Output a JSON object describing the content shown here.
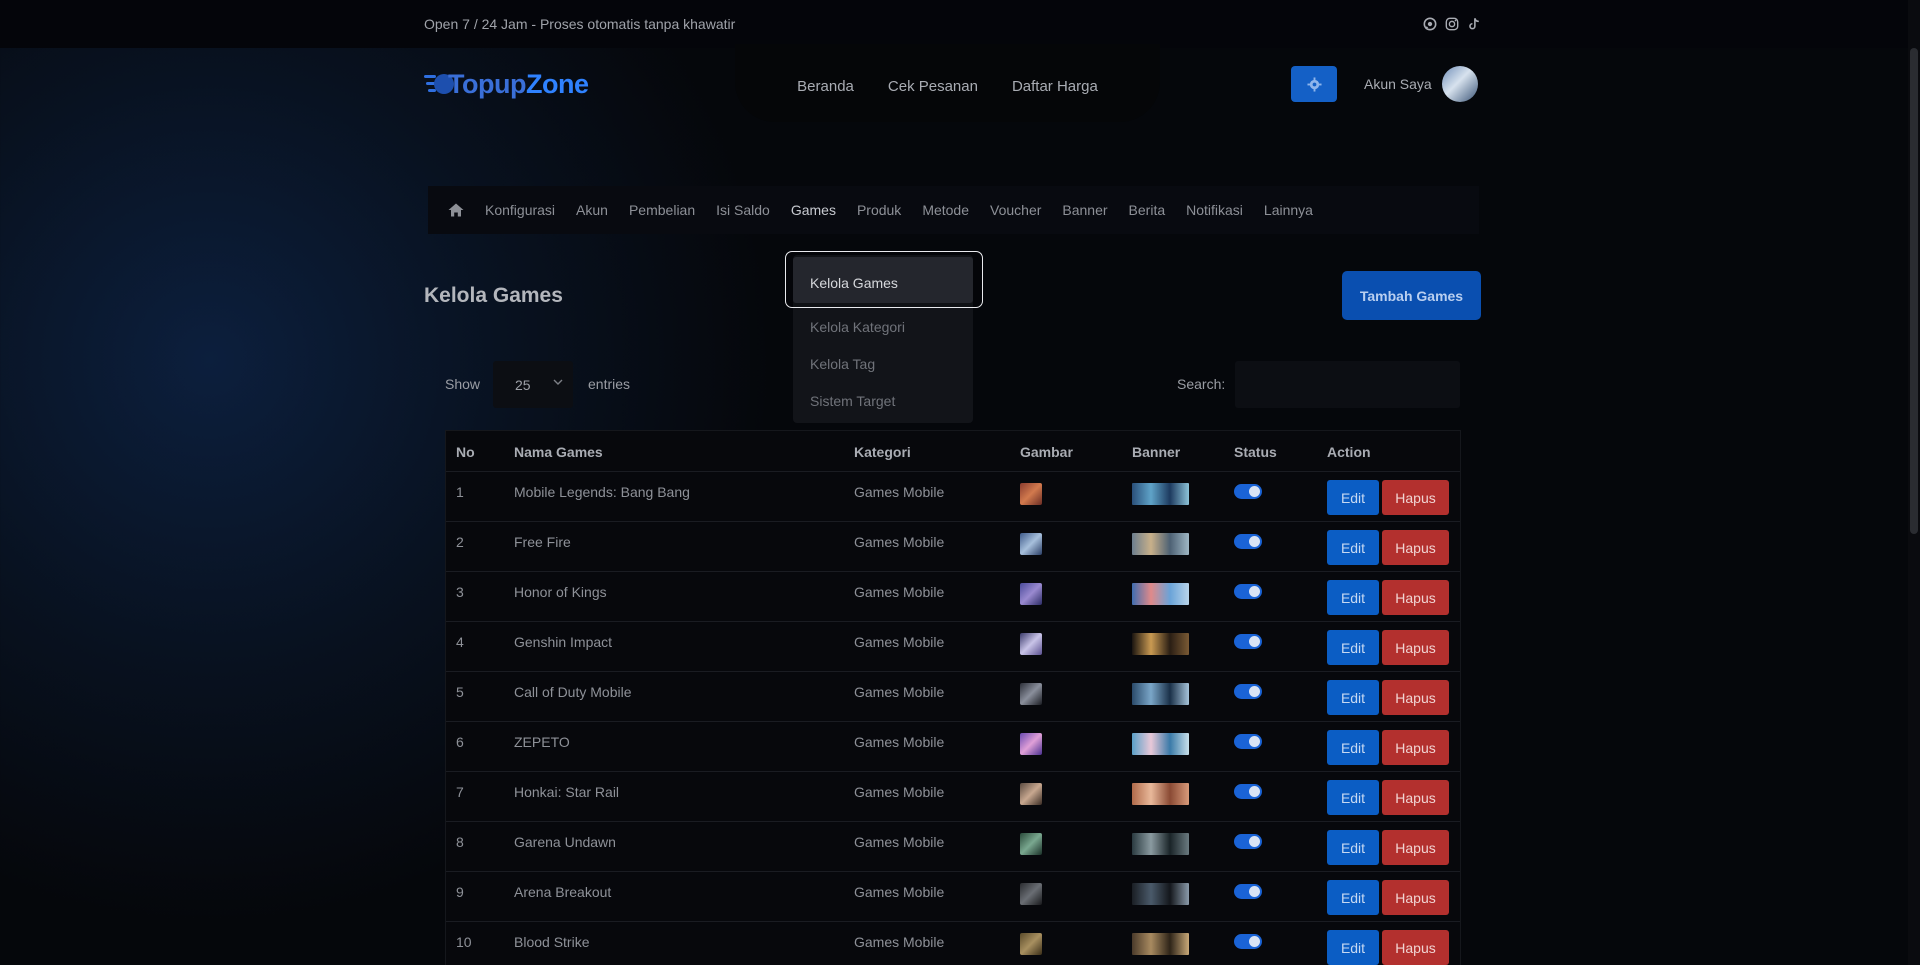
{
  "topbar": {
    "promo": "Open 7 / 24 Jam - Proses otomatis tanpa khawatir",
    "social_icons": [
      "whatsapp-icon",
      "instagram-icon",
      "tiktok-icon"
    ]
  },
  "header": {
    "logo_part1": "Topup",
    "logo_part2": "Zone",
    "nav": [
      "Beranda",
      "Cek Pesanan",
      "Daftar Harga"
    ],
    "account_label": "Akun Saya"
  },
  "menubar": {
    "items": [
      "Konfigurasi",
      "Akun",
      "Pembelian",
      "Isi Saldo",
      "Games",
      "Produk",
      "Metode",
      "Voucher",
      "Banner",
      "Berita",
      "Notifikasi",
      "Lainnya"
    ],
    "active": "Games"
  },
  "dropdown": {
    "items": [
      "Kelola Games",
      "Kelola Kategori",
      "Kelola Tag",
      "Sistem Target"
    ]
  },
  "page": {
    "title": "Kelola Games",
    "add_button": "Tambah Games"
  },
  "table_controls": {
    "show_label": "Show",
    "show_value": "25",
    "entries_label": "entries",
    "search_label": "Search:"
  },
  "table": {
    "headers": [
      "No",
      "Nama Games",
      "Kategori",
      "Gambar",
      "Banner",
      "Status",
      "Action"
    ],
    "edit_label": "Edit",
    "delete_label": "Hapus",
    "rows": [
      {
        "no": "1",
        "name": "Mobile Legends: Bang Bang",
        "kategori": "Games Mobile"
      },
      {
        "no": "2",
        "name": "Free Fire",
        "kategori": "Games Mobile"
      },
      {
        "no": "3",
        "name": "Honor of Kings",
        "kategori": "Games Mobile"
      },
      {
        "no": "4",
        "name": "Genshin Impact",
        "kategori": "Games Mobile"
      },
      {
        "no": "5",
        "name": "Call of Duty Mobile",
        "kategori": "Games Mobile"
      },
      {
        "no": "6",
        "name": "ZEPETO",
        "kategori": "Games Mobile"
      },
      {
        "no": "7",
        "name": "Honkai: Star Rail",
        "kategori": "Games Mobile"
      },
      {
        "no": "8",
        "name": "Garena Undawn",
        "kategori": "Games Mobile"
      },
      {
        "no": "9",
        "name": "Arena Breakout",
        "kategori": "Games Mobile"
      },
      {
        "no": "10",
        "name": "Blood Strike",
        "kategori": "Games Mobile"
      }
    ]
  },
  "colors": {
    "accent": "#0b5dc4",
    "danger": "#b3302e",
    "toggle_on": "#1a63d6"
  }
}
